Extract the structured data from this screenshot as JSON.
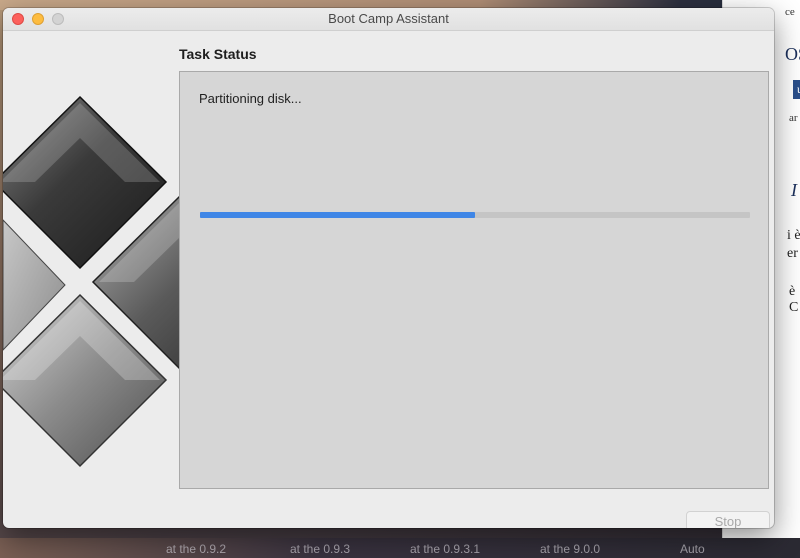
{
  "window": {
    "title": "Boot Camp Assistant"
  },
  "task": {
    "heading": "Task Status",
    "status_text": "Partitioning disk...",
    "progress": 0.5
  },
  "buttons": {
    "stop_label": "Stop"
  },
  "background": {
    "right_fragments": [
      "ce",
      "OS",
      "u",
      "ar",
      "I",
      "i è",
      "er",
      "è",
      "C"
    ],
    "bottom_fragments": [
      "at the 0.9.2",
      "at the 0.9.3",
      "at the 0.9.3.1",
      "at the 9.0.0",
      "Auto"
    ]
  },
  "colors": {
    "progress_fill": "#3f86e6",
    "progress_track": "#c5c5c5",
    "panel_bg": "#d6d6d6",
    "window_bg": "#ececec"
  }
}
